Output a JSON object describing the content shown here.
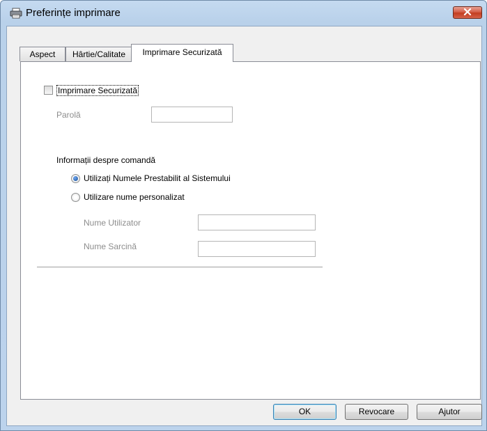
{
  "window": {
    "title": "Preferințe imprimare",
    "close_label": "x"
  },
  "tabs": [
    {
      "label": "Aspect"
    },
    {
      "label": "Hârtie/Calitate"
    },
    {
      "label": "Imprimare Securizată"
    }
  ],
  "secure_print": {
    "checkbox_label": "Imprimare Securizată",
    "checked": false,
    "password_label": "Parolă",
    "password_value": ""
  },
  "job_info": {
    "heading": "Informații despre comandă",
    "option_default": "Utilizați Numele Prestabilit al Sistemului",
    "option_custom": "Utilizare nume personalizat",
    "selected": "default",
    "user_name_label": "Nume Utilizator",
    "user_name_value": "",
    "job_name_label": "Nume Sarcină",
    "job_name_value": ""
  },
  "buttons": {
    "ok": "OK",
    "cancel": "Revocare",
    "help": "Ajutor"
  }
}
